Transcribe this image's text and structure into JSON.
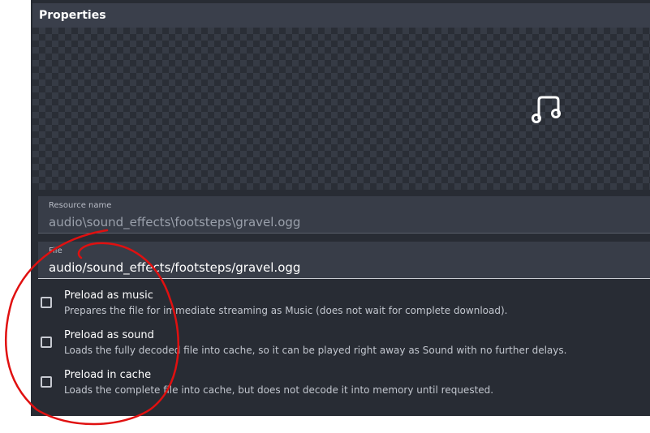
{
  "header": {
    "title": "Properties"
  },
  "preview": {
    "icon": "music-note-icon"
  },
  "resource_name": {
    "label": "Resource name",
    "value": "audio\\sound_effects\\footsteps\\gravel.ogg"
  },
  "file": {
    "label": "File",
    "value": "audio/sound_effects/footsteps/gravel.ogg"
  },
  "options": [
    {
      "title": "Preload as music",
      "description": "Prepares the file for immediate streaming as Music (does not wait for complete download).",
      "checked": false
    },
    {
      "title": "Preload as sound",
      "description": "Loads the fully decoded file into cache, so it can be played right away as Sound with no further delays.",
      "checked": false
    },
    {
      "title": "Preload in cache",
      "description": "Loads the complete file into cache, but does not decode it into memory until requested.",
      "checked": false
    }
  ],
  "colors": {
    "panel": "#282c34",
    "header": "#3a3f4b",
    "field": "#383d48",
    "annotation": "#e01010"
  }
}
